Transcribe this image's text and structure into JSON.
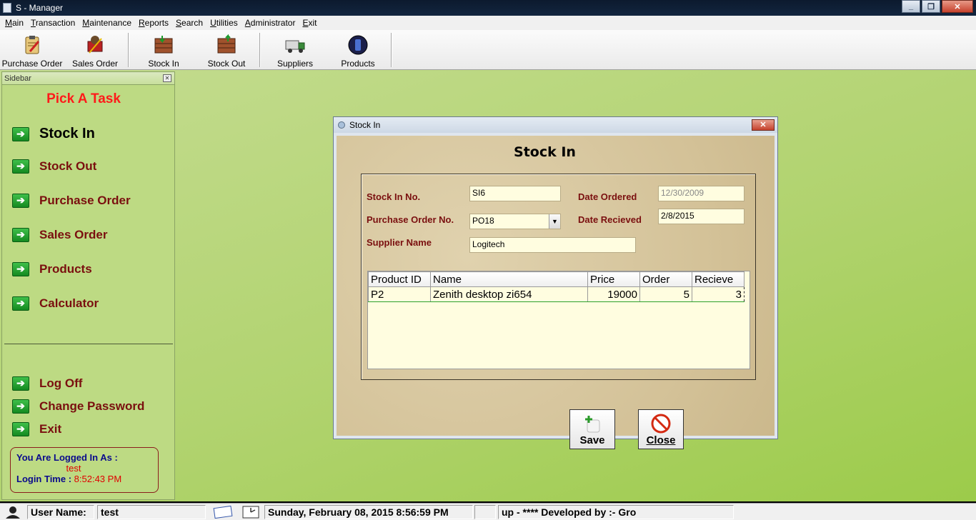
{
  "window": {
    "title": "S - Manager"
  },
  "menu": [
    {
      "underline": "M",
      "rest": "ain"
    },
    {
      "underline": "T",
      "rest": "ransaction"
    },
    {
      "underline": "M",
      "rest": "aintenance"
    },
    {
      "underline": "R",
      "rest": "eports"
    },
    {
      "underline": "S",
      "rest": "earch"
    },
    {
      "underline": "U",
      "rest": "tilities"
    },
    {
      "underline": "A",
      "rest": "dministrator"
    },
    {
      "underline": "E",
      "rest": "xit"
    }
  ],
  "toolbar": {
    "purchase_order": "Purchase Order",
    "sales_order": "Sales Order",
    "stock_in": "Stock In",
    "stock_out": "Stock Out",
    "suppliers": "Suppliers",
    "products": "Products"
  },
  "sidebar": {
    "header": "Sidebar",
    "title": "Pick A Task",
    "tasks": [
      "Stock In",
      "Stock Out",
      "Purchase Order",
      "Sales Order",
      "Products",
      "Calculator"
    ],
    "account": [
      "Log Off",
      "Change Password",
      "Exit"
    ],
    "login": {
      "label": "You Are Logged In As :",
      "user": "test",
      "time_label": "Login Time : ",
      "time": "8:52:43 PM"
    }
  },
  "dialog": {
    "title": "Stock In",
    "heading": "Stock In",
    "labels": {
      "stock_in_no": "Stock In No.",
      "purchase_order_no": "Purchase Order No.",
      "supplier_name": "Supplier Name",
      "date_ordered": "Date Ordered",
      "date_received": "Date Recieved"
    },
    "values": {
      "stock_in_no": "SI6",
      "purchase_order_no": "PO18",
      "supplier_name": "Logitech",
      "date_ordered": "12/30/2009",
      "date_received": "2/8/2015"
    },
    "grid": {
      "columns": [
        "Product ID",
        "Name",
        "Price",
        "Order",
        "Recieve"
      ],
      "rows": [
        {
          "product_id": "P2",
          "name": "Zenith desktop zi654",
          "price": "19000",
          "order": "5",
          "recieve": "3"
        }
      ]
    },
    "buttons": {
      "save": "Save",
      "close": "Close"
    }
  },
  "statusbar": {
    "user_label": "User Name:",
    "user": "test",
    "datetime": "Sunday, February 08, 2015  8:56:59 PM",
    "developer": "up - **** Developed by :- Gro"
  },
  "colors": {
    "desktop": "#b1d36f",
    "sidebar": "#bdda83",
    "task_text": "#7a0f0f",
    "title_red": "#ff1a1a"
  }
}
